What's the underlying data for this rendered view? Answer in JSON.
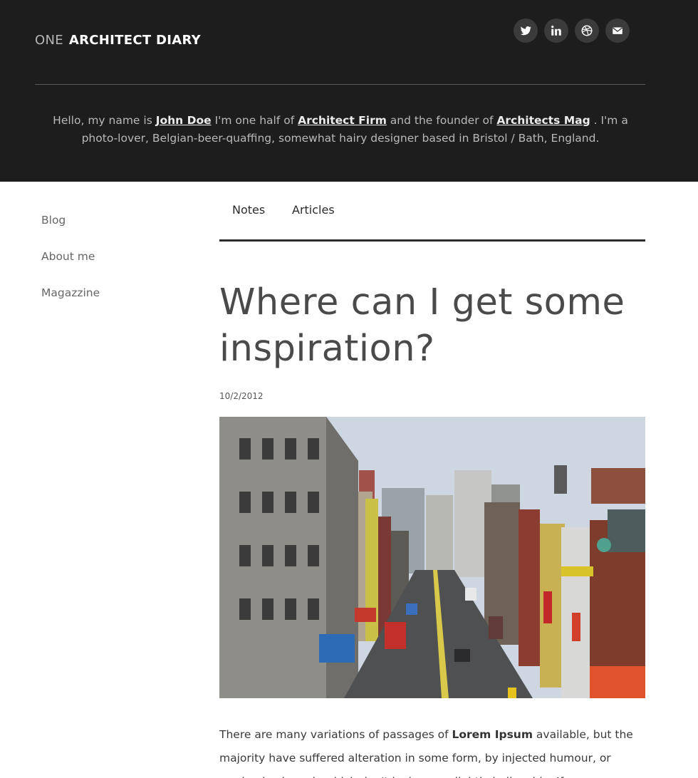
{
  "header": {
    "brand_prefix": "ONE",
    "brand_name": "ARCHITECT DIARY",
    "social": [
      {
        "icon": "twitter-icon"
      },
      {
        "icon": "linkedin-icon"
      },
      {
        "icon": "dribbble-icon"
      },
      {
        "icon": "mail-icon"
      }
    ],
    "intro": {
      "t1": "Hello, my name is ",
      "link1": "John Doe",
      "t2": "  I'm one half of ",
      "link2": "Architect Firm",
      "t3": " and the founder of ",
      "link3": "Architects Mag",
      "t4": " . I'm a photo-lover, Belgian-beer-quaffing, somewhat hairy designer based in Bristol / Bath, England."
    }
  },
  "sidebar": {
    "items": [
      {
        "label": "Blog"
      },
      {
        "label": "About me"
      },
      {
        "label": "Magazzine"
      }
    ]
  },
  "tabs": [
    {
      "label": "Notes"
    },
    {
      "label": "Articles"
    }
  ],
  "article": {
    "title": "Where can I get some inspiration?",
    "date": "10/2/2012",
    "body_start": "There are many variations of passages of ",
    "body_bold": "Lorem Ipsum",
    "body_end": " available, but the majority have suffered alteration in some form, by injected humour, or randomised words which don't look even slightly believable. If you are"
  },
  "colors": {
    "header_bg": "#1d1d1e",
    "social_bg": "#3b3b3c",
    "tab_rule": "#2b2b2b"
  }
}
